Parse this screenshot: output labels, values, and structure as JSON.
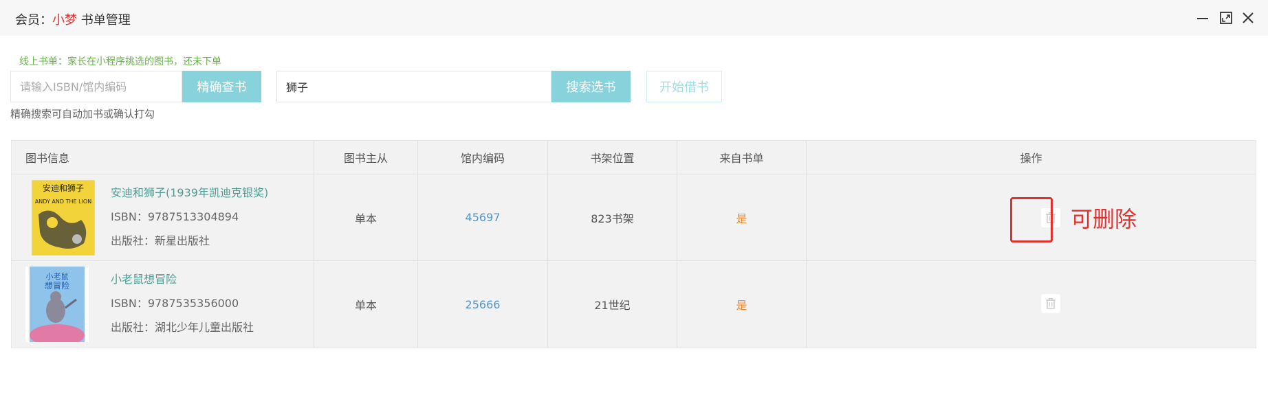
{
  "window": {
    "title_prefix": "会员：",
    "member_name": "小梦",
    "title_suffix": " 书单管理"
  },
  "hint": "线上书单：家长在小程序挑选的图书，还未下单",
  "search": {
    "isbn_placeholder": "请输入ISBN/馆内编码",
    "exact_button": "精确查书",
    "keyword_value": "狮子",
    "search_button": "搜索选书",
    "borrow_button": "开始借书",
    "note": "精确搜索可自动加书或确认打勾"
  },
  "table": {
    "headers": [
      "图书信息",
      "图书主从",
      "馆内编码",
      "书架位置",
      "来自书单",
      "操作"
    ],
    "rows": [
      {
        "title": "安迪和狮子(1939年凯迪克银奖)",
        "isbn": "ISBN：9787513304894",
        "publisher": "出版社：新星出版社",
        "type": "单本",
        "code": "45697",
        "shelf": "823书架",
        "from_list": "是",
        "cover_text": [
          "安迪和狮子",
          "ANDY AND THE LION"
        ],
        "cover_color": "#f2d43a"
      },
      {
        "title": "小老鼠想冒险",
        "isbn": "ISBN：9787535356000",
        "publisher": "出版社：湖北少年儿童出版社",
        "type": "单本",
        "code": "25666",
        "shelf": "21世纪",
        "from_list": "是",
        "cover_text": [
          "小老鼠",
          "想冒险"
        ],
        "cover_color": "#8fc3ea"
      }
    ]
  },
  "annotation": "可删除",
  "colors": {
    "accent_button": "#87d2db",
    "highlight_red": "#e0312f",
    "title_green": "#4b9e93",
    "code_blue": "#4f95c7",
    "yes_orange": "#f08a27"
  },
  "icons": {
    "minimize": "minimize-icon",
    "maximize": "maximize-icon",
    "close": "close-icon",
    "delete": "trash-icon"
  }
}
